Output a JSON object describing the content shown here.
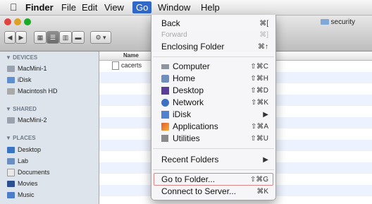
{
  "menubar": {
    "apple": "",
    "items": [
      "Finder",
      "File",
      "Edit",
      "View",
      "Go",
      "Window",
      "Help"
    ]
  },
  "toolbar": {
    "nav_back": "◀",
    "nav_forward": "▶",
    "view_icon": "▦",
    "view_list": "☰",
    "view_column": "▥",
    "view_cover": "▬",
    "action": "⚙ ▾",
    "window_title": "security"
  },
  "sidebar": {
    "devices_header": "▼ DEVICES",
    "devices": [
      "MacMini-1",
      "iDisk",
      "Macintosh HD"
    ],
    "shared_header": "▼ SHARED",
    "shared": [
      "MacMini-2"
    ],
    "places_header": "▼ PLACES",
    "places": [
      "Desktop",
      "Lab",
      "Documents",
      "Movies",
      "Music"
    ]
  },
  "content": {
    "column_name": "Name",
    "file": "cacerts"
  },
  "go_menu": {
    "back": {
      "label": "Back",
      "shortcut": "⌘["
    },
    "forward": {
      "label": "Forward",
      "shortcut": "⌘]"
    },
    "enclosing": {
      "label": "Enclosing Folder",
      "shortcut": "⌘↑"
    },
    "computer": {
      "label": "Computer",
      "shortcut": "⇧⌘C"
    },
    "home": {
      "label": "Home",
      "shortcut": "⇧⌘H"
    },
    "desktop": {
      "label": "Desktop",
      "shortcut": "⇧⌘D"
    },
    "network": {
      "label": "Network",
      "shortcut": "⇧⌘K"
    },
    "idisk": {
      "label": "iDisk",
      "shortcut": "▶"
    },
    "applications": {
      "label": "Applications",
      "shortcut": "⇧⌘A"
    },
    "utilities": {
      "label": "Utilities",
      "shortcut": "⇧⌘U"
    },
    "recent": {
      "label": "Recent Folders",
      "shortcut": "▶"
    },
    "goto": {
      "label": "Go to Folder...",
      "shortcut": "⇧⌘G"
    },
    "connect": {
      "label": "Connect to Server...",
      "shortcut": "⌘K"
    }
  }
}
